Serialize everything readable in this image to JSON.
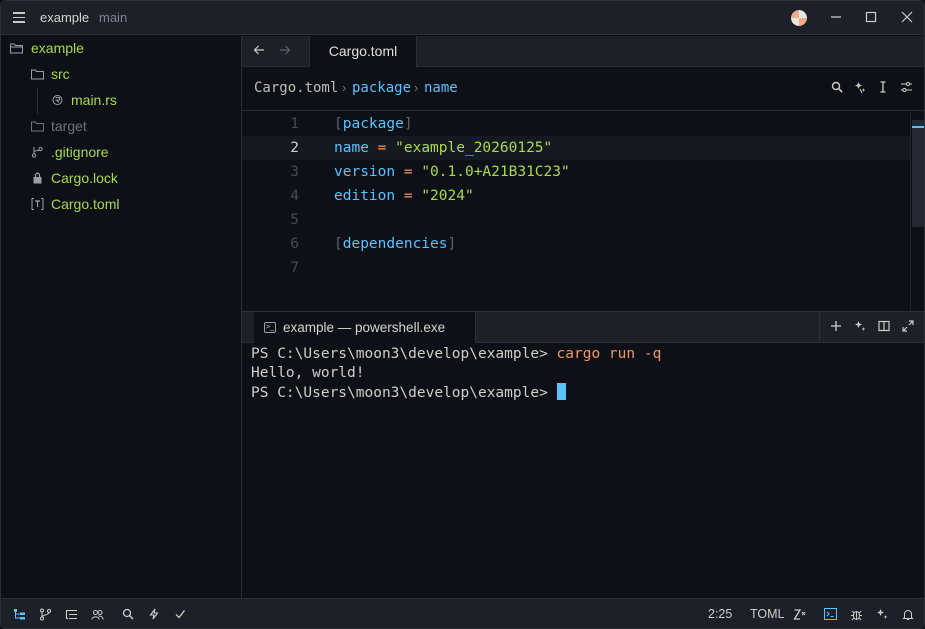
{
  "titlebar": {
    "project": "example",
    "branch": "main"
  },
  "sidebar": {
    "items": [
      {
        "label": "example",
        "color": "#aad94c",
        "icon": "folder-open-icon"
      },
      {
        "label": "src",
        "color": "#aad94c",
        "icon": "folder-icon"
      },
      {
        "label": "main.rs",
        "color": "#aad94c",
        "icon": "rust-file-icon"
      },
      {
        "label": "target",
        "color": "#6c7380",
        "icon": "folder-icon"
      },
      {
        "label": ".gitignore",
        "color": "#aad94c",
        "icon": "git-icon"
      },
      {
        "label": "Cargo.lock",
        "color": "#aad94c",
        "icon": "lock-icon"
      },
      {
        "label": "Cargo.toml",
        "color": "#aad94c",
        "icon": "toml-file-icon"
      }
    ]
  },
  "editor": {
    "tab": "Cargo.toml",
    "breadcrumb": [
      "Cargo.toml",
      "package",
      "name"
    ],
    "lines": [
      {
        "num": "1",
        "parts": [
          [
            "[",
            "c-bracket"
          ],
          [
            "package",
            "c-section"
          ],
          [
            "]",
            "c-bracket"
          ]
        ]
      },
      {
        "num": "2",
        "parts": [
          [
            "name",
            "c-key"
          ],
          [
            " = ",
            "c-op"
          ],
          [
            "\"example_20260125\"",
            "c-str"
          ]
        ]
      },
      {
        "num": "3",
        "parts": [
          [
            "version",
            "c-key"
          ],
          [
            " = ",
            "c-op"
          ],
          [
            "\"0.1.0+A21B31C23\"",
            "c-str"
          ]
        ]
      },
      {
        "num": "4",
        "parts": [
          [
            "edition",
            "c-key"
          ],
          [
            " = ",
            "c-op"
          ],
          [
            "\"2024\"",
            "c-str"
          ]
        ]
      },
      {
        "num": "5",
        "parts": []
      },
      {
        "num": "6",
        "parts": [
          [
            "[",
            "c-bracket"
          ],
          [
            "dependencies",
            "c-section"
          ],
          [
            "]",
            "c-bracket"
          ]
        ]
      },
      {
        "num": "7",
        "parts": []
      }
    ],
    "active_line": 2
  },
  "terminal": {
    "tab": "example — powershell.exe",
    "prompt": "PS C:\\Users\\moon3\\develop\\example> ",
    "command": "cargo run -q",
    "output": "Hello, world!"
  },
  "statusbar": {
    "position": "2:25",
    "language": "TOML"
  },
  "colors": {
    "accent": "#59c2ff",
    "string": "#aad94c",
    "operator": "#f29668"
  }
}
